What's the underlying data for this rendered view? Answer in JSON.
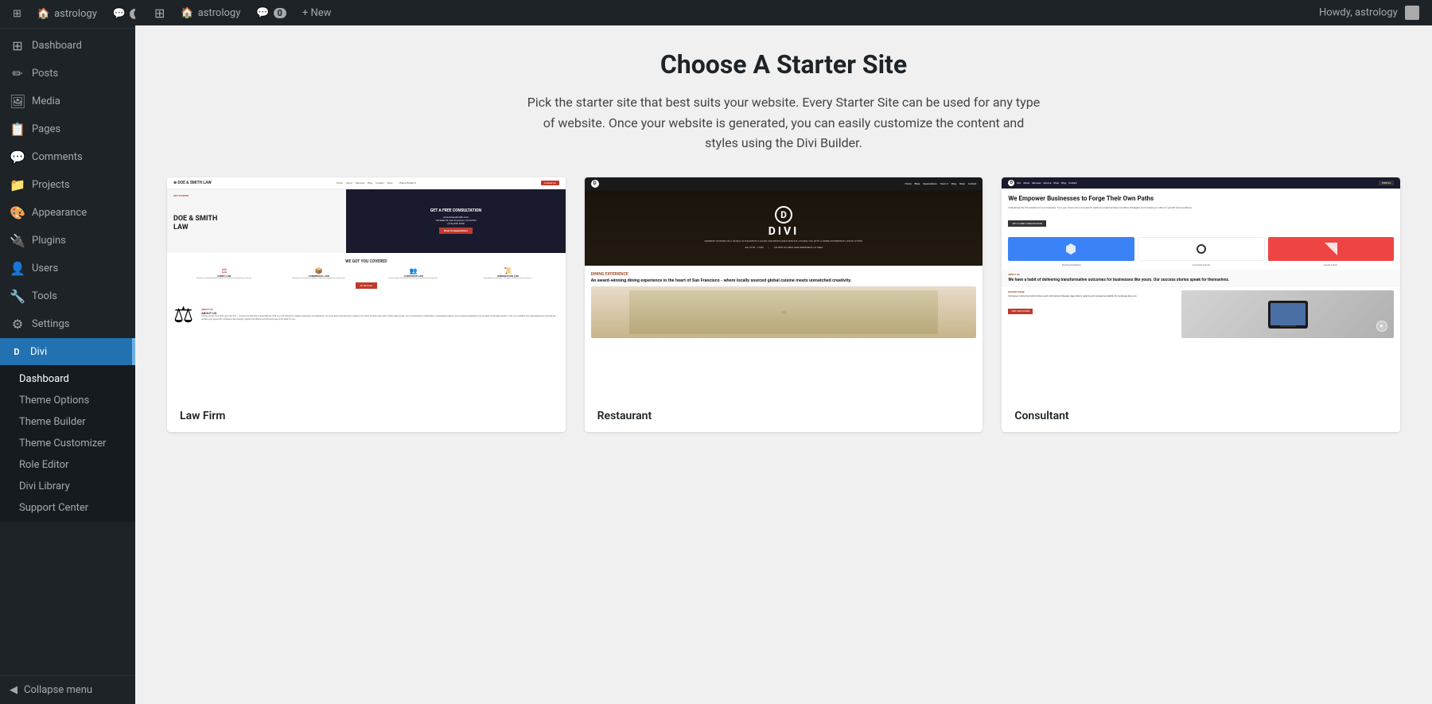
{
  "topbar": {
    "wp_logo": "⊞",
    "site_name": "astrology",
    "comments_label": "Comments",
    "comments_count": "0",
    "new_label": "+ New",
    "howdy": "Howdy, astrology"
  },
  "sidebar": {
    "site_label": "astrology",
    "dashboard_label": "Dashboard",
    "nav_items": [
      {
        "id": "dashboard",
        "label": "Dashboard",
        "icon": "⊞"
      },
      {
        "id": "posts",
        "label": "Posts",
        "icon": "📄"
      },
      {
        "id": "media",
        "label": "Media",
        "icon": "🖼"
      },
      {
        "id": "pages",
        "label": "Pages",
        "icon": "📋"
      },
      {
        "id": "comments",
        "label": "Comments",
        "icon": "💬"
      },
      {
        "id": "projects",
        "label": "Projects",
        "icon": "📁"
      },
      {
        "id": "appearance",
        "label": "Appearance",
        "icon": "🎨"
      },
      {
        "id": "plugins",
        "label": "Plugins",
        "icon": "🔌"
      },
      {
        "id": "users",
        "label": "Users",
        "icon": "👤"
      },
      {
        "id": "tools",
        "label": "Tools",
        "icon": "🔧"
      },
      {
        "id": "settings",
        "label": "Settings",
        "icon": "⚙"
      },
      {
        "id": "divi",
        "label": "Divi",
        "icon": "D",
        "active": true
      }
    ],
    "divi_sub_items": [
      {
        "id": "divi-dashboard",
        "label": "Dashboard",
        "current": true
      },
      {
        "id": "theme-options",
        "label": "Theme Options"
      },
      {
        "id": "theme-builder",
        "label": "Theme Builder"
      },
      {
        "id": "theme-customizer",
        "label": "Theme Customizer"
      },
      {
        "id": "role-editor",
        "label": "Role Editor"
      },
      {
        "id": "divi-library",
        "label": "Divi Library"
      },
      {
        "id": "support-center",
        "label": "Support Center"
      }
    ],
    "collapse_label": "Collapse menu"
  },
  "main": {
    "heading": "Choose A Starter Site",
    "description": "Pick the starter site that best suits your website. Every Starter Site can be used for any type of website. Once your website is generated, you can easily customize the content and styles using the Divi Builder.",
    "starter_sites": [
      {
        "id": "law-firm",
        "label": "Law Firm",
        "preview_type": "law-firm"
      },
      {
        "id": "restaurant",
        "label": "Restaurant",
        "preview_type": "restaurant"
      },
      {
        "id": "consultant",
        "label": "Consultant",
        "preview_type": "consultant"
      }
    ]
  }
}
